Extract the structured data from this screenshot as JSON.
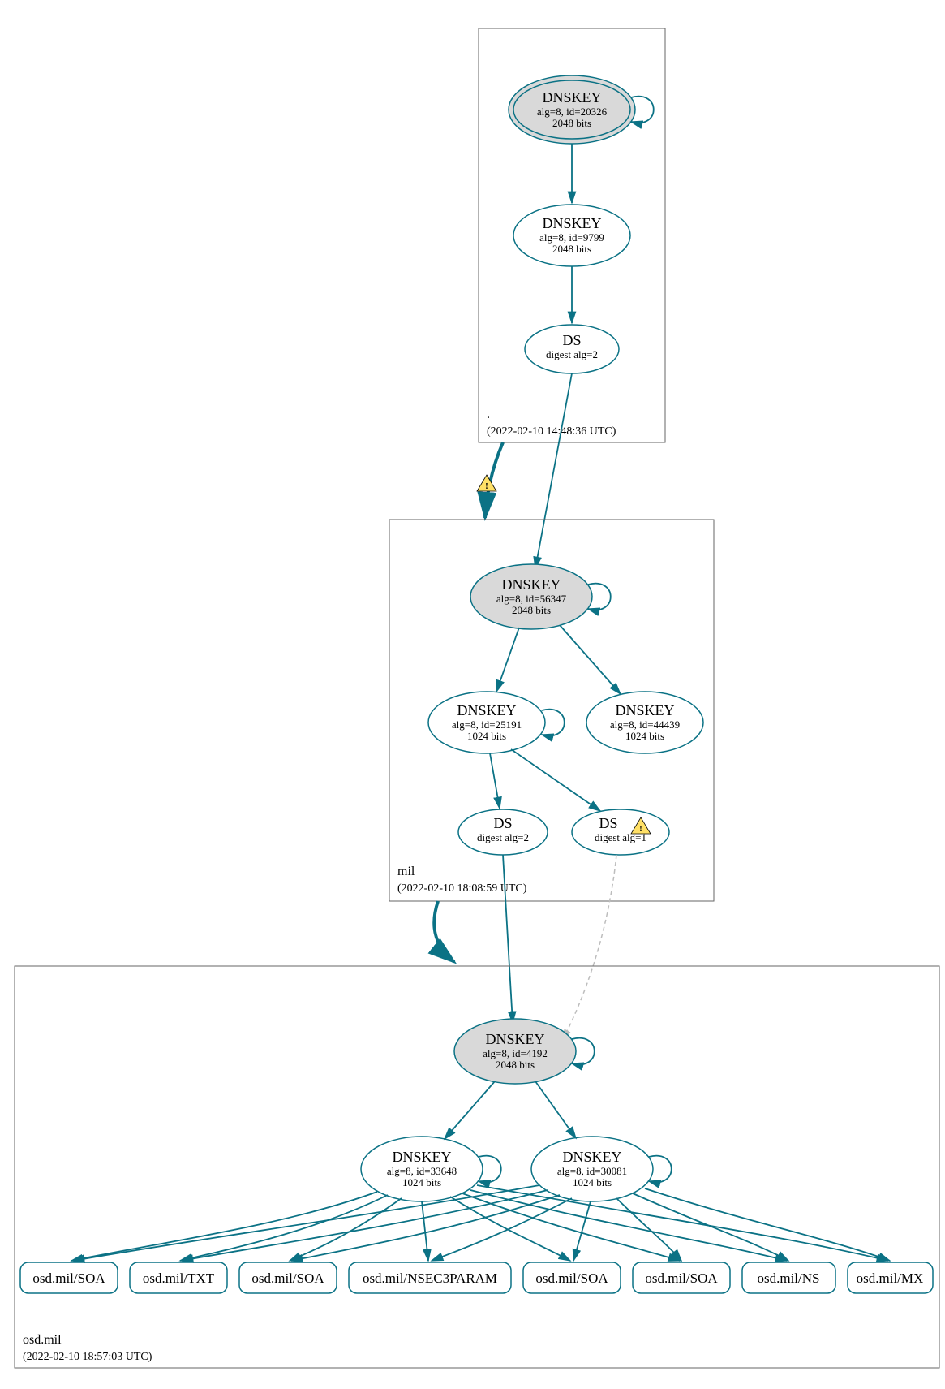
{
  "zones": {
    "root": {
      "label": ".",
      "timestamp": "(2022-02-10 14:48:36 UTC)"
    },
    "mil": {
      "label": "mil",
      "timestamp": "(2022-02-10 18:08:59 UTC)"
    },
    "osd": {
      "label": "osd.mil",
      "timestamp": "(2022-02-10 18:57:03 UTC)"
    }
  },
  "nodes": {
    "root_ksk": {
      "title": "DNSKEY",
      "sub1": "alg=8, id=20326",
      "sub2": "2048 bits"
    },
    "root_zsk": {
      "title": "DNSKEY",
      "sub1": "alg=8, id=9799",
      "sub2": "2048 bits"
    },
    "root_ds": {
      "title": "DS",
      "sub1": "digest alg=2"
    },
    "mil_ksk": {
      "title": "DNSKEY",
      "sub1": "alg=8, id=56347",
      "sub2": "2048 bits"
    },
    "mil_zsk1": {
      "title": "DNSKEY",
      "sub1": "alg=8, id=25191",
      "sub2": "1024 bits"
    },
    "mil_zsk2": {
      "title": "DNSKEY",
      "sub1": "alg=8, id=44439",
      "sub2": "1024 bits"
    },
    "mil_ds1": {
      "title": "DS",
      "sub1": "digest alg=2"
    },
    "mil_ds2": {
      "title": "DS",
      "sub1": "digest alg=1"
    },
    "osd_ksk": {
      "title": "DNSKEY",
      "sub1": "alg=8, id=4192",
      "sub2": "2048 bits"
    },
    "osd_zsk1": {
      "title": "DNSKEY",
      "sub1": "alg=8, id=33648",
      "sub2": "1024 bits"
    },
    "osd_zsk2": {
      "title": "DNSKEY",
      "sub1": "alg=8, id=30081",
      "sub2": "1024 bits"
    }
  },
  "rrsets": [
    "osd.mil/SOA",
    "osd.mil/TXT",
    "osd.mil/SOA",
    "osd.mil/NSEC3PARAM",
    "osd.mil/SOA",
    "osd.mil/SOA",
    "osd.mil/NS",
    "osd.mil/MX"
  ],
  "colors": {
    "teal": "#0b7285",
    "gray_fill": "#d9d9d9",
    "box_stroke": "#666666"
  }
}
